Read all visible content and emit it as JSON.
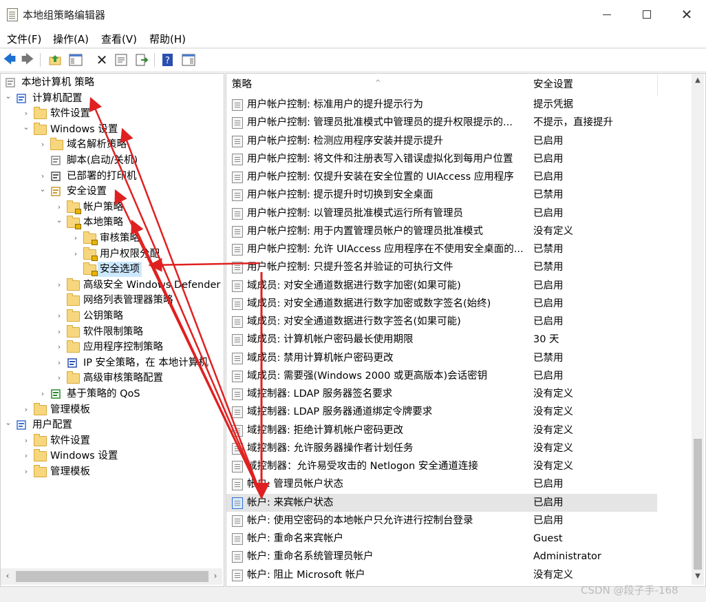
{
  "window": {
    "title": "本地组策略编辑器",
    "minimize_icon": "minimize-icon",
    "maximize_icon": "maximize-icon",
    "close_glyph": "✕"
  },
  "menu": [
    "文件(F)",
    "操作(A)",
    "查看(V)",
    "帮助(H)"
  ],
  "toolbar_icons": [
    "back-arrow-icon",
    "forward-arrow-icon",
    "up-folder-icon",
    "show-hide-tree-icon",
    "delete-icon",
    "properties-icon",
    "export-icon",
    "help-icon",
    "action-pane-icon"
  ],
  "tree": [
    {
      "label": "本地计算机 策略",
      "level": 0,
      "toggle": "",
      "icon": "policy-doc-icon"
    },
    {
      "label": "计算机配置",
      "level": 0,
      "toggle": "⌄",
      "icon": "computer-icon"
    },
    {
      "label": "软件设置",
      "level": 1,
      "toggle": "›",
      "icon": "folder-icon"
    },
    {
      "label": "Windows 设置",
      "level": 1,
      "toggle": "⌄",
      "icon": "folder-icon"
    },
    {
      "label": "域名解析策略",
      "level": 2,
      "toggle": "›",
      "icon": "folder-icon"
    },
    {
      "label": "脚本(启动/关机)",
      "level": 2,
      "toggle": "",
      "icon": "script-icon"
    },
    {
      "label": "已部署的打印机",
      "level": 2,
      "toggle": "›",
      "icon": "printer-icon"
    },
    {
      "label": "安全设置",
      "level": 2,
      "toggle": "⌄",
      "icon": "security-settings-icon"
    },
    {
      "label": "帐户策略",
      "level": 3,
      "toggle": "›",
      "icon": "lock-folder-icon"
    },
    {
      "label": "本地策略",
      "level": 3,
      "toggle": "⌄",
      "icon": "lock-folder-icon"
    },
    {
      "label": "审核策略",
      "level": 4,
      "toggle": "›",
      "icon": "lock-folder-icon"
    },
    {
      "label": "用户权限分配",
      "level": 4,
      "toggle": "›",
      "icon": "lock-folder-icon"
    },
    {
      "label": "安全选项",
      "level": 4,
      "toggle": "",
      "icon": "lock-folder-icon",
      "selected": true
    },
    {
      "label": "高级安全 Windows Defender",
      "level": 3,
      "toggle": "›",
      "icon": "folder-icon"
    },
    {
      "label": "网络列表管理器策略",
      "level": 3,
      "toggle": "",
      "icon": "folder-icon"
    },
    {
      "label": "公钥策略",
      "level": 3,
      "toggle": "›",
      "icon": "folder-icon"
    },
    {
      "label": "软件限制策略",
      "level": 3,
      "toggle": "›",
      "icon": "folder-icon"
    },
    {
      "label": "应用程序控制策略",
      "level": 3,
      "toggle": "›",
      "icon": "folder-icon"
    },
    {
      "label": "IP 安全策略，在 本地计算机",
      "level": 3,
      "toggle": "›",
      "icon": "ip-security-icon"
    },
    {
      "label": "高级审核策略配置",
      "level": 3,
      "toggle": "›",
      "icon": "folder-icon"
    },
    {
      "label": "基于策略的 QoS",
      "level": 2,
      "toggle": "›",
      "icon": "qos-chart-icon"
    },
    {
      "label": "管理模板",
      "level": 1,
      "toggle": "›",
      "icon": "folder-icon"
    },
    {
      "label": "用户配置",
      "level": 0,
      "toggle": "⌄",
      "icon": "user-config-icon"
    },
    {
      "label": "软件设置",
      "level": 1,
      "toggle": "›",
      "icon": "folder-icon"
    },
    {
      "label": "Windows 设置",
      "level": 1,
      "toggle": "›",
      "icon": "folder-icon"
    },
    {
      "label": "管理模板",
      "level": 1,
      "toggle": "›",
      "icon": "folder-icon"
    }
  ],
  "list": {
    "columns": [
      "策略",
      "安全设置"
    ],
    "sort_caret": "^",
    "rows": [
      {
        "policy": "用户帐户控制: 标准用户的提升提示行为",
        "setting": "提示凭据"
      },
      {
        "policy": "用户帐户控制: 管理员批准模式中管理员的提升权限提示的...",
        "setting": "不提示，直接提升"
      },
      {
        "policy": "用户帐户控制: 检测应用程序安装并提示提升",
        "setting": "已启用"
      },
      {
        "policy": "用户帐户控制: 将文件和注册表写入错误虚拟化到每用户位置",
        "setting": "已启用"
      },
      {
        "policy": "用户帐户控制: 仅提升安装在安全位置的 UIAccess 应用程序",
        "setting": "已启用"
      },
      {
        "policy": "用户帐户控制: 提示提升时切换到安全桌面",
        "setting": "已禁用"
      },
      {
        "policy": "用户帐户控制: 以管理员批准模式运行所有管理员",
        "setting": "已启用"
      },
      {
        "policy": "用户帐户控制: 用于内置管理员帐户的管理员批准模式",
        "setting": "没有定义"
      },
      {
        "policy": "用户帐户控制: 允许 UIAccess 应用程序在不使用安全桌面的...",
        "setting": "已禁用"
      },
      {
        "policy": "用户帐户控制: 只提升签名并验证的可执行文件",
        "setting": "已禁用"
      },
      {
        "policy": "域成员: 对安全通道数据进行数字加密(如果可能)",
        "setting": "已启用"
      },
      {
        "policy": "域成员: 对安全通道数据进行数字加密或数字签名(始终)",
        "setting": "已启用"
      },
      {
        "policy": "域成员: 对安全通道数据进行数字签名(如果可能)",
        "setting": "已启用"
      },
      {
        "policy": "域成员: 计算机帐户密码最长使用期限",
        "setting": "30 天"
      },
      {
        "policy": "域成员: 禁用计算机帐户密码更改",
        "setting": "已禁用"
      },
      {
        "policy": "域成员: 需要强(Windows 2000 或更高版本)会话密钥",
        "setting": "已启用"
      },
      {
        "policy": "域控制器: LDAP 服务器签名要求",
        "setting": "没有定义"
      },
      {
        "policy": "域控制器: LDAP 服务器通道绑定令牌要求",
        "setting": "没有定义"
      },
      {
        "policy": "域控制器: 拒绝计算机帐户密码更改",
        "setting": "没有定义"
      },
      {
        "policy": "域控制器: 允许服务器操作者计划任务",
        "setting": "没有定义"
      },
      {
        "policy": "域控制器：允许易受攻击的 Netlogon 安全通道连接",
        "setting": "没有定义"
      },
      {
        "policy": "帐户: 管理员帐户状态",
        "setting": "已启用"
      },
      {
        "policy": "帐户: 来宾帐户状态",
        "setting": "已启用",
        "selected": true
      },
      {
        "policy": "帐户: 使用空密码的本地帐户只允许进行控制台登录",
        "setting": "已启用"
      },
      {
        "policy": "帐户: 重命名来宾帐户",
        "setting": "Guest"
      },
      {
        "policy": "帐户: 重命名系统管理员帐户",
        "setting": "Administrator"
      },
      {
        "policy": "帐户: 阻止 Microsoft 帐户",
        "setting": "没有定义"
      }
    ]
  },
  "watermark": "CSDN @段子手-168",
  "annotation_color": "#e02020"
}
